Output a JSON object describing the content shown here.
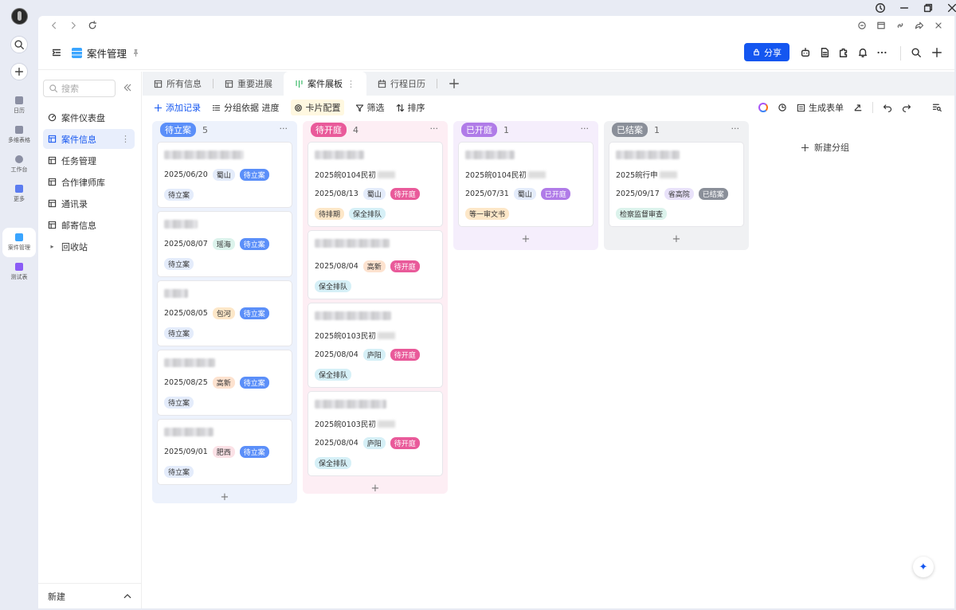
{
  "rail": {
    "items": [
      {
        "label": "日历",
        "color": "#8b8fa3"
      },
      {
        "label": "多维表格",
        "color": "#8b8fa3"
      },
      {
        "label": "工作台",
        "color": "#8b8fa3"
      },
      {
        "label": "更多",
        "color": "#5b7cf0"
      },
      {
        "label": "案件管理",
        "color": "#3aa5ff"
      },
      {
        "label": "测试表",
        "color": "#8b5cf6"
      }
    ]
  },
  "header": {
    "title": "案件管理",
    "share_label": "分享"
  },
  "sidebar": {
    "search_placeholder": "搜索",
    "items": [
      {
        "label": "案件仪表盘",
        "icon": "dashboard-icon"
      },
      {
        "label": "案件信息",
        "icon": "table-icon"
      },
      {
        "label": "任务管理",
        "icon": "table-icon"
      },
      {
        "label": "合作律师库",
        "icon": "table-icon"
      },
      {
        "label": "通讯录",
        "icon": "table-icon"
      },
      {
        "label": "邮寄信息",
        "icon": "table-icon"
      },
      {
        "label": "回收站",
        "icon": "caret-right-icon"
      }
    ],
    "footer_label": "新建"
  },
  "tabs": [
    {
      "label": "所有信息"
    },
    {
      "label": "重要进展"
    },
    {
      "label": "案件展板"
    },
    {
      "label": "行程日历"
    }
  ],
  "toolbar": {
    "add_record": "添加记录",
    "group_by": "分组依据 进度",
    "card_config": "卡片配置",
    "filter": "筛选",
    "sort": "排序",
    "generate_form": "生成表单"
  },
  "board": {
    "new_group": "新建分组",
    "columns": [
      {
        "title": "待立案",
        "count": "5",
        "color": "#5b8ff9",
        "bg": "#edf2fc",
        "cards": [
          {
            "date": "2025/06/20",
            "region": "蜀山",
            "status": "待立案",
            "tags": [
              "待立案"
            ]
          },
          {
            "date": "2025/08/07",
            "region": "瑶海",
            "status": "待立案",
            "tags": [
              "待立案"
            ]
          },
          {
            "date": "2025/08/05",
            "region": "包河",
            "status": "待立案",
            "tags": [
              "待立案"
            ]
          },
          {
            "date": "2025/08/25",
            "region": "高新",
            "status": "待立案",
            "tags": [
              "待立案"
            ]
          },
          {
            "date": "2025/09/01",
            "region": "肥西",
            "status": "待立案",
            "tags": [
              "待立案"
            ]
          }
        ]
      },
      {
        "title": "待开庭",
        "count": "4",
        "color": "#e95a9a",
        "bg": "#fdeef4",
        "cards": [
          {
            "case_no": "2025皖0104民初",
            "date": "2025/08/13",
            "region": "蜀山",
            "status": "待开庭",
            "tags": [
              "待排期",
              "保全排队"
            ]
          },
          {
            "case_no": "",
            "date": "2025/08/04",
            "region": "高新",
            "status": "待开庭",
            "tags": [
              "保全排队"
            ]
          },
          {
            "case_no": "2025皖0103民初",
            "date": "2025/08/04",
            "region": "庐阳",
            "status": "待开庭",
            "tags": [
              "保全排队"
            ]
          },
          {
            "case_no": "2025皖0103民初",
            "date": "2025/08/04",
            "region": "庐阳",
            "status": "待开庭",
            "tags": [
              "保全排队"
            ]
          }
        ]
      },
      {
        "title": "已开庭",
        "count": "1",
        "color": "#b07be8",
        "bg": "#f5eefc",
        "cards": [
          {
            "case_no": "2025皖0104民初",
            "date": "2025/07/31",
            "region": "蜀山",
            "status": "已开庭",
            "tags": [
              "等一审文书"
            ]
          }
        ]
      },
      {
        "title": "已结案",
        "count": "1",
        "color": "#8a8f99",
        "bg": "#f0f1f3",
        "cards": [
          {
            "case_no": "2025皖行申",
            "date": "2025/09/17",
            "region": "省高院",
            "status": "已结案",
            "tags": [
              "检察监督审查"
            ]
          }
        ]
      }
    ]
  }
}
